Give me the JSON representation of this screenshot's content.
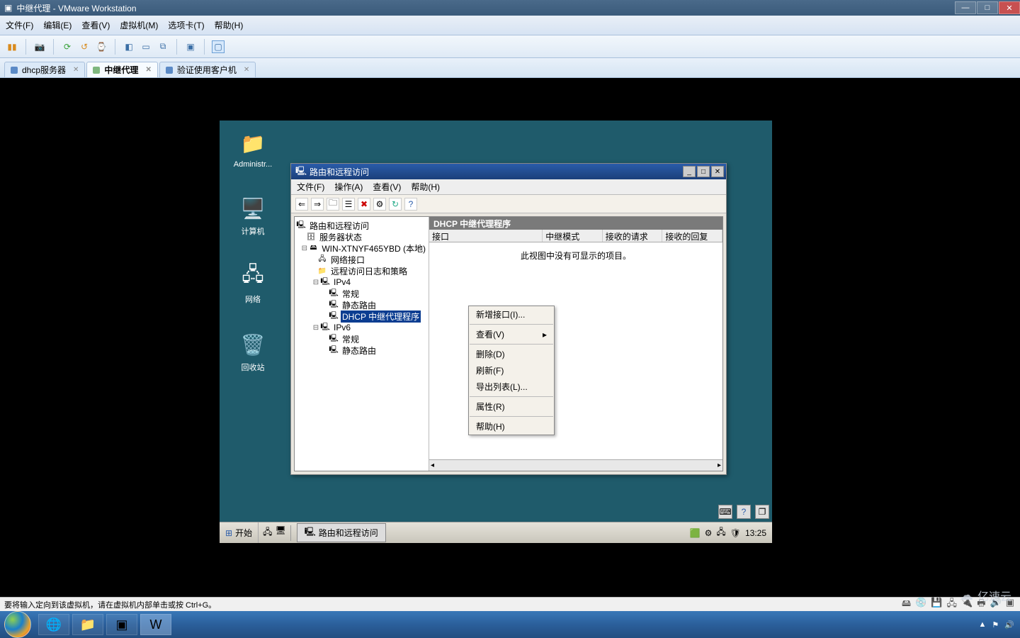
{
  "host": {
    "title": "中继代理 - VMware Workstation",
    "menus": [
      "文件(F)",
      "编辑(E)",
      "查看(V)",
      "虚拟机(M)",
      "选项卡(T)",
      "帮助(H)"
    ],
    "tabs": [
      {
        "label": "dhcp服务器",
        "active": false
      },
      {
        "label": "中继代理",
        "active": true
      },
      {
        "label": "验证使用客户机",
        "active": false
      }
    ],
    "status": "要将输入定向到该虚拟机，请在虚拟机内部单击或按 Ctrl+G。",
    "watermark": "亿速云"
  },
  "guest": {
    "desktop_icons": [
      {
        "name": "administrator",
        "label": "Administr...",
        "glyph": "📁"
      },
      {
        "name": "computer",
        "label": "计算机",
        "glyph": "🖥️"
      },
      {
        "name": "network",
        "label": "网络",
        "glyph": "🖧"
      },
      {
        "name": "recycle",
        "label": "回收站",
        "glyph": "🗑️"
      }
    ],
    "taskbar": {
      "start": "开始",
      "task": "路由和远程访问",
      "clock": "13:25"
    }
  },
  "mmc": {
    "title": "路由和远程访问",
    "menus": [
      "文件(F)",
      "操作(A)",
      "查看(V)",
      "帮助(H)"
    ],
    "tree": {
      "root": "路由和远程访问",
      "server_status": "服务器状态",
      "server": "WIN-XTNYF465YBD (本地)",
      "net_if": "网络接口",
      "remote_log": "远程访问日志和策略",
      "ipv4": "IPv4",
      "ipv4_general": "常规",
      "ipv4_static": "静态路由",
      "ipv4_dhcp": "DHCP 中继代理程序",
      "ipv6": "IPv6",
      "ipv6_general": "常规",
      "ipv6_static": "静态路由"
    },
    "detail": {
      "header": "DHCP 中继代理程序",
      "cols": [
        "接口",
        "中继模式",
        "接收的请求",
        "接收的回复"
      ],
      "empty": "此视图中没有可显示的项目。"
    },
    "ctx": [
      "新增接口(I)...",
      "查看(V)",
      "删除(D)",
      "刷新(F)",
      "导出列表(L)...",
      "属性(R)",
      "帮助(H)"
    ]
  }
}
